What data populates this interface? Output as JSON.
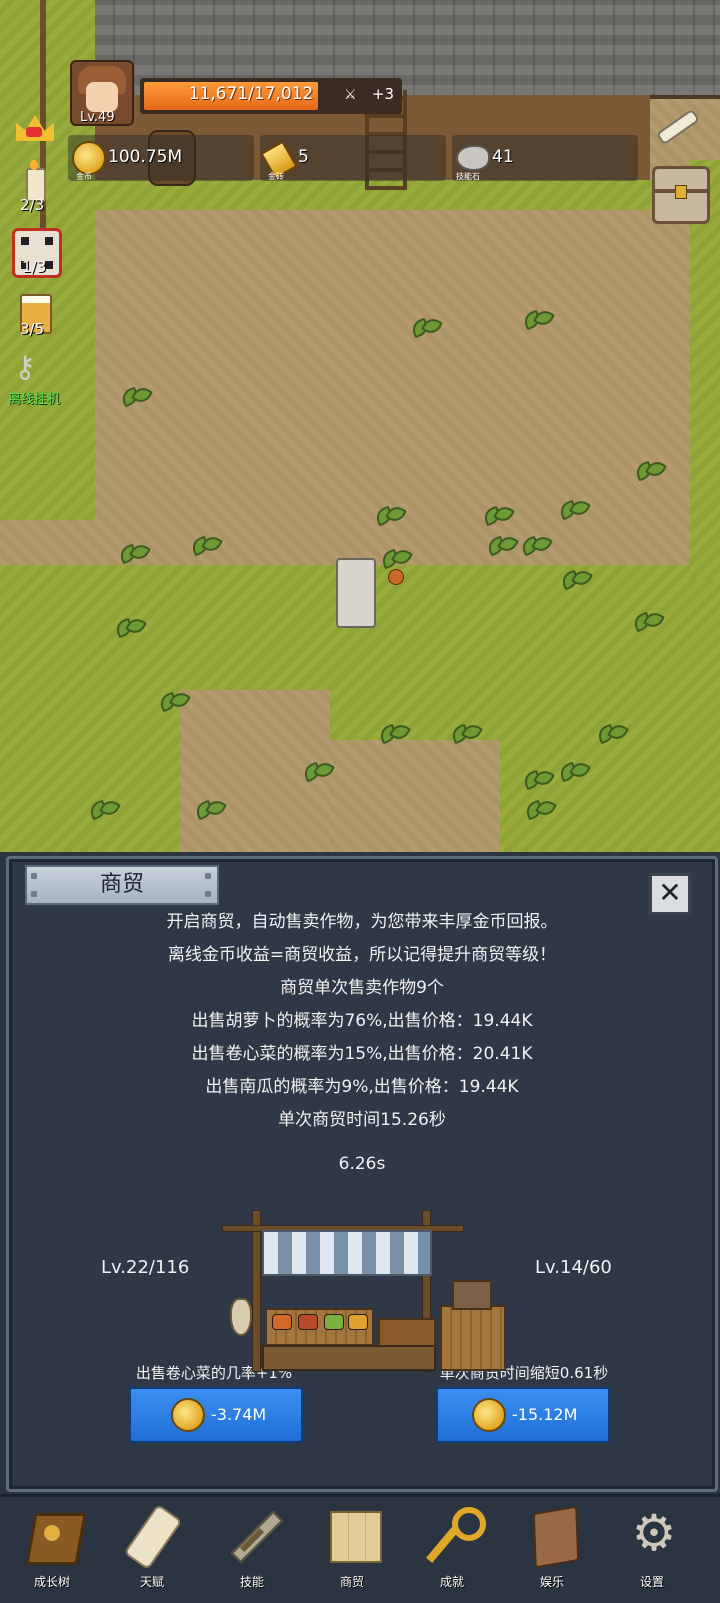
{
  "hud": {
    "level": "Lv.49",
    "hp_text": "11,671/17,012",
    "hp_fraction": 0.686,
    "hp_bonus": "+3",
    "gold_value": "100.75M",
    "gold_label": "金币",
    "bar_value": "5",
    "bar_label": "金砖",
    "stone_value": "41",
    "stone_label": "技能石"
  },
  "left_icons": {
    "candle_count": "2/3",
    "dice_count": "1/3",
    "beer_count": "3/5",
    "idle_label": "离线挂机"
  },
  "panel": {
    "title": "商贸",
    "close": "✕",
    "lines": [
      "开启商贸，自动售卖作物，为您带来丰厚金币回报。",
      "离线金币收益=商贸收益，所以记得提升商贸等级！",
      "商贸单次售卖作物9个",
      "出售胡萝卜的概率为76%,出售价格：19.44K",
      "出售卷心菜的概率为15%,出售价格：20.41K",
      "出售南瓜的概率为9%,出售价格：19.44K",
      "单次商贸时间15.26秒"
    ],
    "timer": "6.26s",
    "left_level": "Lv.22/116",
    "right_level": "Lv.14/60",
    "left_upgrade_label": "出售卷心菜的几率+1%",
    "right_upgrade_label": "单次商贸时间缩短0.61秒",
    "left_cost": "-3.74M",
    "right_cost": "-15.12M"
  },
  "nav": [
    {
      "label": "成长树",
      "icon": "book-icon"
    },
    {
      "label": "天赋",
      "icon": "scroll-icon"
    },
    {
      "label": "技能",
      "icon": "sword-icon"
    },
    {
      "label": "商贸",
      "icon": "map-icon"
    },
    {
      "label": "成就",
      "icon": "key-icon"
    },
    {
      "label": "娱乐",
      "icon": "cloth-icon"
    },
    {
      "label": "设置",
      "icon": "gear-icon"
    }
  ]
}
